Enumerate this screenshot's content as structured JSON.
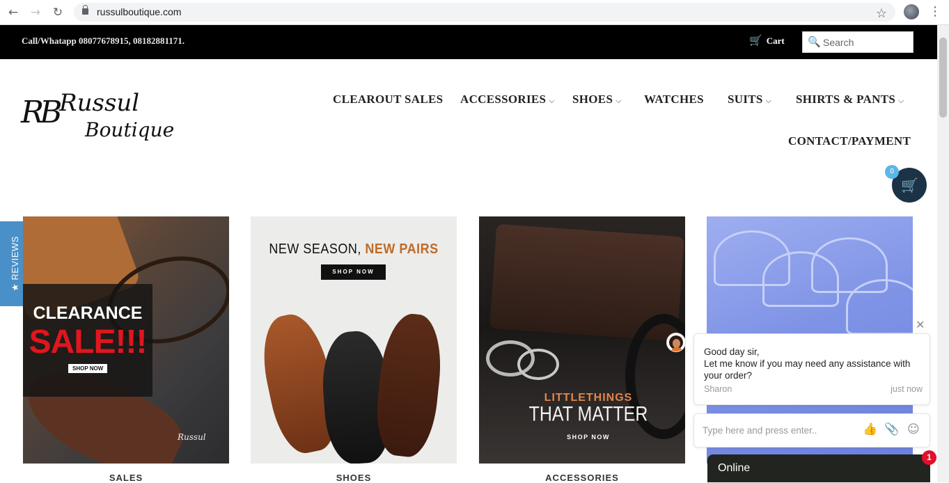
{
  "browser": {
    "url": "russulboutique.com",
    "icons": [
      "back-icon",
      "forward-icon",
      "reload-icon",
      "lock-icon",
      "star-icon",
      "profile-avatar",
      "more-vert-icon"
    ],
    "back_glyph": "←",
    "forward_glyph": "→",
    "reload_glyph": "↻",
    "star_glyph": "☆",
    "more_glyph": "⋮"
  },
  "topbar": {
    "phone": "Call/Whatapp 08077678915, 08182881171.",
    "cart_label": "Cart",
    "cart_glyph": "🛒",
    "search_glyph": "🔍",
    "search_placeholder": "Search"
  },
  "logo": {
    "monogram": "RB",
    "line1": "Russul",
    "line2": "Boutique"
  },
  "nav": {
    "items": [
      {
        "label": "CLEAROUT SALES",
        "dropdown": false
      },
      {
        "label": "ACCESSORIES",
        "dropdown": true
      },
      {
        "label": "SHOES",
        "dropdown": true
      },
      {
        "label": "WATCHES",
        "dropdown": false
      },
      {
        "label": "SUITS",
        "dropdown": true
      },
      {
        "label": "SHIRTS & PANTS",
        "dropdown": true
      },
      {
        "label": "CONTACT/PAYMENT",
        "dropdown": false
      }
    ],
    "chevron": "⌵"
  },
  "floating_cart": {
    "count": "0",
    "glyph": "🛒",
    "color": "#1c3347",
    "badge_color": "#5bb6e8"
  },
  "reviews_tab": {
    "label": "★ REVIEWS",
    "color": "#4a90c8"
  },
  "tiles": [
    {
      "caption": "SALES",
      "heading": "CLEARANCE",
      "big": "SALE!!!",
      "button": "SHOP NOW",
      "signature": "Russul"
    },
    {
      "caption": "SHOES",
      "heading_part1": "NEW SEASON, ",
      "heading_part2": "NEW PAIRS",
      "button": "SHOP NOW"
    },
    {
      "caption": "ACCESSORIES",
      "line1": "LITTLETHINGS",
      "line2": "THAT MATTER",
      "button": "SHOP NOW"
    },
    {
      "caption": ""
    }
  ],
  "chat": {
    "message": "Good day sir,\nLet me know if you may need any assistance with your order?",
    "agent": "Sharon",
    "time": "just now",
    "input_placeholder": "Type here and press enter..",
    "status": "Online",
    "unread": "1",
    "close_glyph": "✕",
    "like_glyph": "👍",
    "attach_glyph": "📎",
    "emoji_glyph": "☺"
  }
}
